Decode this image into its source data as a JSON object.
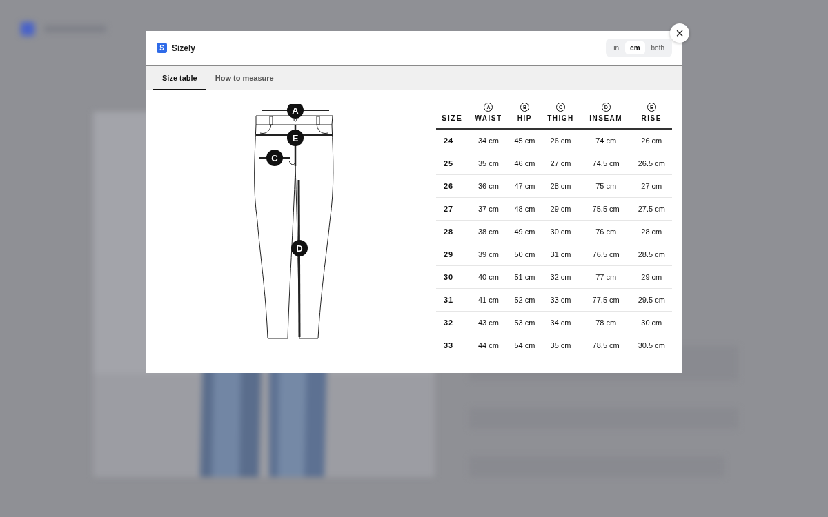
{
  "modal": {
    "brand": {
      "logo": "S",
      "name": "Sizely"
    },
    "units": [
      {
        "label": "in",
        "selected": false
      },
      {
        "label": "cm",
        "selected": true
      },
      {
        "label": "both",
        "selected": false
      }
    ],
    "close": "×",
    "tabs": [
      {
        "label": "Size table",
        "selected": true
      },
      {
        "label": "How to measure",
        "selected": false
      }
    ],
    "diagram": {
      "markers": [
        "A",
        "E",
        "C",
        "D"
      ]
    },
    "table": {
      "size_header": "SIZE",
      "columns": [
        {
          "letter": "A",
          "name": "WAIST"
        },
        {
          "letter": "B",
          "name": "HIP"
        },
        {
          "letter": "C",
          "name": "THIGH"
        },
        {
          "letter": "D",
          "name": "INSEAM"
        },
        {
          "letter": "E",
          "name": "RISE"
        }
      ],
      "rows": [
        {
          "size": "24",
          "values": [
            "34 cm",
            "45 cm",
            "26 cm",
            "74 cm",
            "26 cm"
          ]
        },
        {
          "size": "25",
          "values": [
            "35 cm",
            "46 cm",
            "27 cm",
            "74.5 cm",
            "26.5 cm"
          ]
        },
        {
          "size": "26",
          "values": [
            "36 cm",
            "47 cm",
            "28 cm",
            "75 cm",
            "27 cm"
          ]
        },
        {
          "size": "27",
          "values": [
            "37 cm",
            "48 cm",
            "29 cm",
            "75.5 cm",
            "27.5 cm"
          ]
        },
        {
          "size": "28",
          "values": [
            "38 cm",
            "49 cm",
            "30 cm",
            "76 cm",
            "28 cm"
          ]
        },
        {
          "size": "29",
          "values": [
            "39 cm",
            "50 cm",
            "31 cm",
            "76.5 cm",
            "28.5 cm"
          ]
        },
        {
          "size": "30",
          "values": [
            "40 cm",
            "51 cm",
            "32 cm",
            "77 cm",
            "29 cm"
          ]
        },
        {
          "size": "31",
          "values": [
            "41 cm",
            "52 cm",
            "33 cm",
            "77.5 cm",
            "29.5 cm"
          ]
        },
        {
          "size": "32",
          "values": [
            "43 cm",
            "53 cm",
            "34 cm",
            "78 cm",
            "30 cm"
          ]
        },
        {
          "size": "33",
          "values": [
            "44 cm",
            "54 cm",
            "35 cm",
            "78.5 cm",
            "30.5 cm"
          ]
        }
      ]
    }
  }
}
